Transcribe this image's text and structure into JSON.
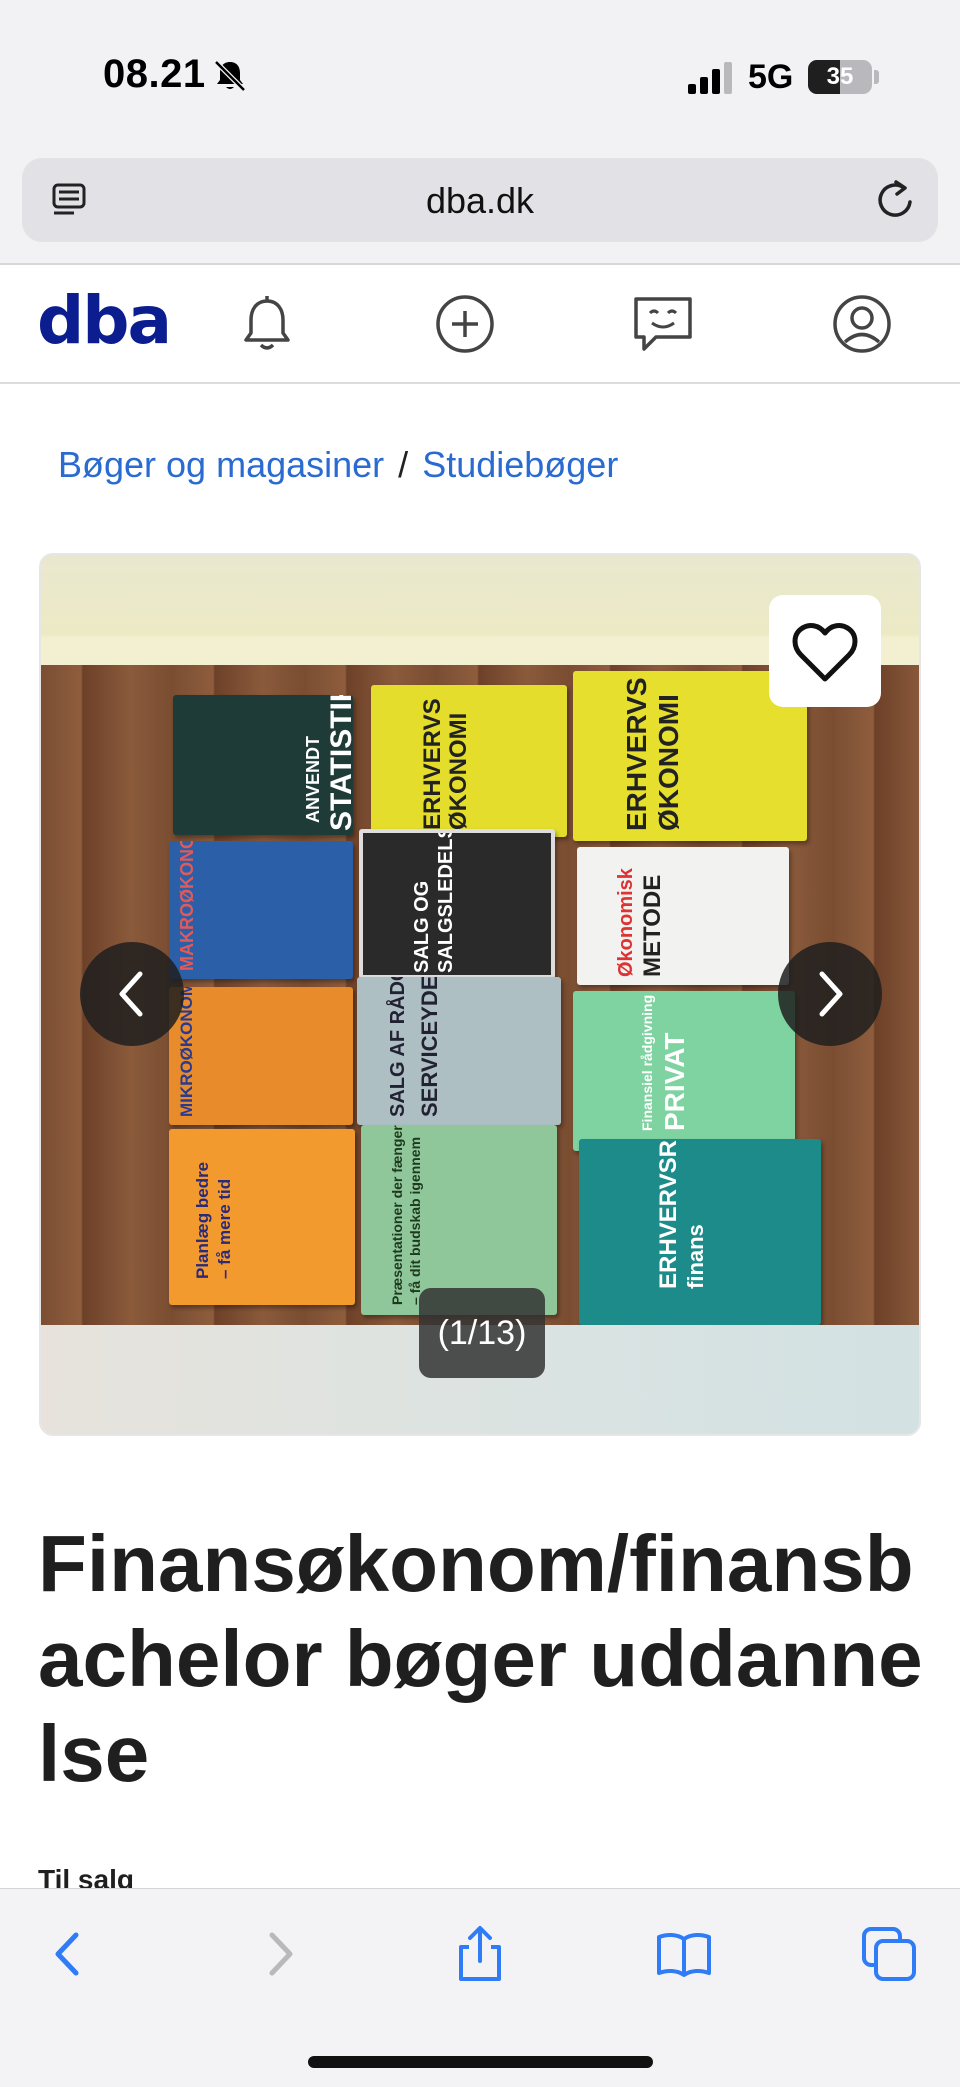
{
  "status_bar": {
    "time": "08.21",
    "network": "5G",
    "battery": "35",
    "icons": [
      "bell-slash-icon",
      "signal-icon",
      "battery-icon"
    ]
  },
  "browser": {
    "url": "dba.dk",
    "icons": [
      "reader-icon",
      "reload-icon"
    ]
  },
  "site_nav": {
    "logo": "dba",
    "logo_color": "#0b1d8f",
    "icons": [
      "notifications-icon",
      "create-listing-icon",
      "messages-icon",
      "profile-icon"
    ]
  },
  "breadcrumb": {
    "items": [
      "Bøger og magasiner",
      "Studiebøger"
    ],
    "separator": "/"
  },
  "gallery": {
    "counter": "(1/13)",
    "current": 1,
    "total": 13,
    "icons": [
      "heart-icon",
      "chevron-left-icon",
      "chevron-right-icon"
    ],
    "books": [
      {
        "line1": "ANVENDT",
        "line2": "STATISTIK"
      },
      {
        "line1": "ERHVERVS",
        "line2": "ØKONOMI"
      },
      {
        "line1": "ERHVERVS",
        "line2": "ØKONOMI"
      },
      {
        "line1": "MAKROØKONOMI",
        "line2": ""
      },
      {
        "line1": "SALG OG",
        "line2": "SALGSLEDELSE"
      },
      {
        "line1": "Økonomisk",
        "line2": "METODE"
      },
      {
        "line1": "MIKROØKONOMI",
        "line2": ""
      },
      {
        "line1": "SALG AF RÅDGIVNING OG",
        "line2": "SERVICEYDELSER"
      },
      {
        "line1": "Finansiel rådgivning",
        "line2": "PRIVAT"
      },
      {
        "line1": "Planlæg bedre",
        "line2": "– få mere tid"
      },
      {
        "line1": "Præsentationer der fænger",
        "line2": "– få dit budskab igennem"
      },
      {
        "line1": "ERHVERVSRET",
        "line2": "finans"
      }
    ]
  },
  "listing": {
    "title": "Finansøkonom/finansbachelor bøger uddannelse",
    "status": "Til salg"
  },
  "toolbar": {
    "icons": [
      "back-icon",
      "forward-icon",
      "share-icon",
      "bookmarks-icon",
      "tabs-icon"
    ]
  }
}
